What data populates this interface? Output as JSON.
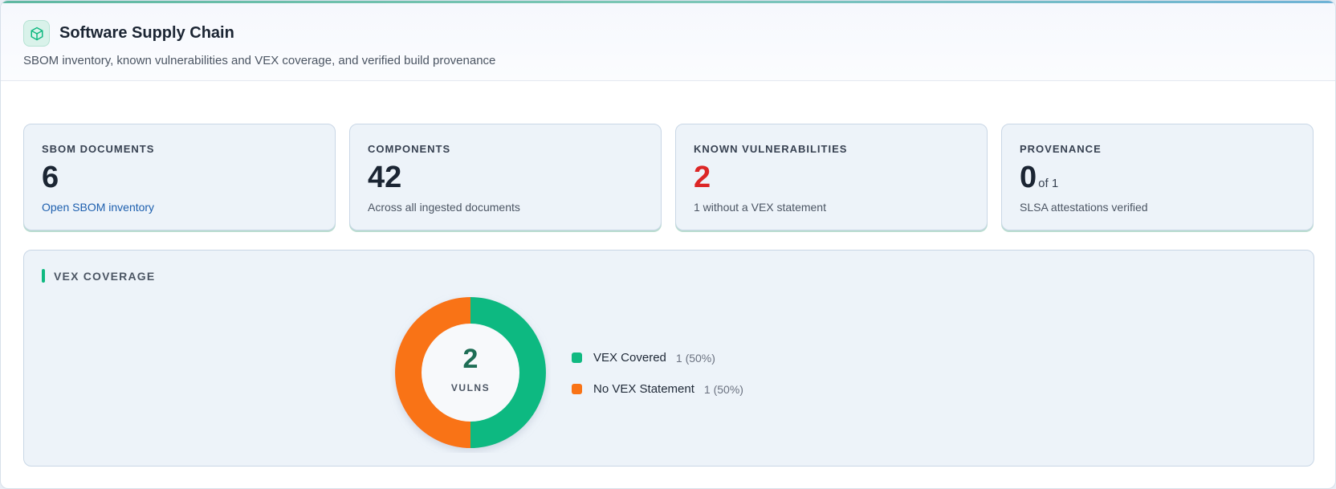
{
  "header": {
    "title": "Software Supply Chain",
    "subtitle": "SBOM inventory, known vulnerabilities and VEX coverage, and verified build provenance",
    "icon": "package-icon",
    "icon_color": "#10b981"
  },
  "cards": [
    {
      "label": "SBOM DOCUMENTS",
      "value": "6",
      "foot": "Open SBOM inventory"
    },
    {
      "label": "COMPONENTS",
      "value": "42",
      "foot": "Across all ingested documents"
    },
    {
      "label": "KNOWN VULNERABILITIES",
      "value": "2",
      "foot": "1 without a VEX statement",
      "value_color": "#dc2626"
    },
    {
      "label": "PROVENANCE",
      "value": "0",
      "of": "of 1",
      "foot": "SLSA attestations verified"
    }
  ],
  "vex": {
    "title": "VEX COVERAGE",
    "center_value": "2",
    "center_label": "VULNS",
    "legend": [
      {
        "label": "VEX Covered",
        "value": "1 (50%)",
        "color": "#10b981"
      },
      {
        "label": "No VEX Statement",
        "value": "1 (50%)",
        "color": "#f97316"
      }
    ]
  },
  "chart_data": {
    "type": "pie",
    "categories": [
      "VEX Covered",
      "No VEX Statement"
    ],
    "values": [
      1,
      1
    ],
    "colors": [
      "#10b981",
      "#f97316"
    ]
  }
}
